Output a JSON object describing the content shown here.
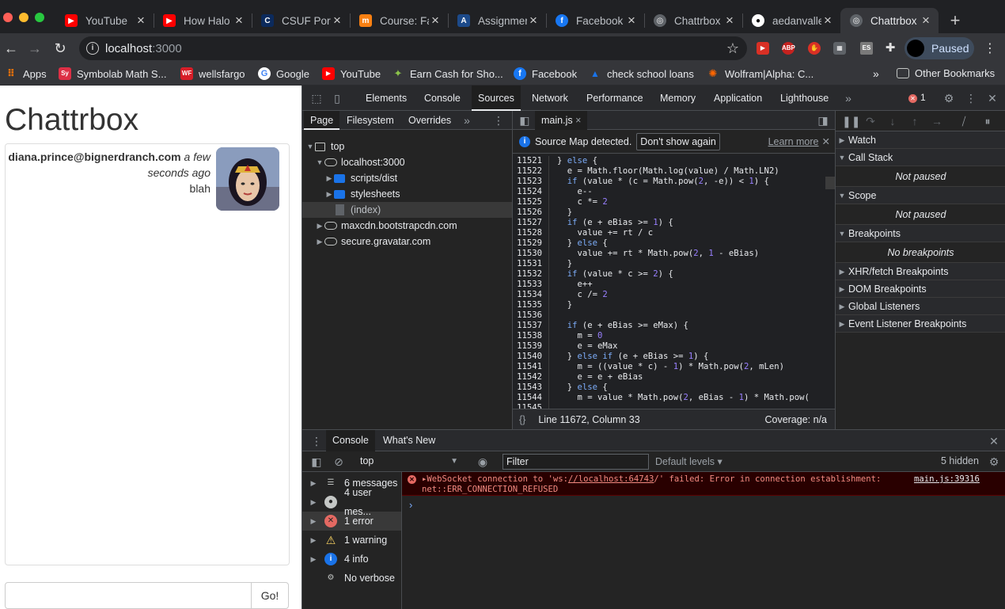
{
  "tabs": [
    {
      "label": "YouTube",
      "icon": "youtube-icon",
      "color": "#ff0000"
    },
    {
      "label": "How Halo",
      "icon": "youtube-icon",
      "color": "#ff0000"
    },
    {
      "label": "CSUF Port",
      "icon": "csuf-icon",
      "color": "#0b2a5c"
    },
    {
      "label": "Course: Fa",
      "icon": "moodle-icon",
      "color": "#f98012"
    },
    {
      "label": "Assignmer",
      "icon": "assignment-icon",
      "color": "#1c4a8a"
    },
    {
      "label": "Facebook",
      "icon": "facebook-icon",
      "color": "#1877f2"
    },
    {
      "label": "Chattrbox",
      "icon": "globe-icon",
      "color": "#9aa0a6"
    },
    {
      "label": "aedanvalle",
      "icon": "github-icon",
      "color": "#ffffff"
    },
    {
      "label": "Chattrbox",
      "icon": "globe-icon",
      "color": "#9aa0a6"
    }
  ],
  "address": {
    "host": "localhost",
    "port": ":3000"
  },
  "profile": {
    "label": "Paused"
  },
  "bookmarks": [
    {
      "label": "Apps",
      "icon": "apps-grid-icon",
      "color": "#e8710a"
    },
    {
      "label": "Symbolab Math S...",
      "icon": "symbolab-icon",
      "color": "#dd2f45"
    },
    {
      "label": "wellsfargo",
      "icon": "wellsfargo-icon",
      "color": "#d71e28"
    },
    {
      "label": "Google",
      "icon": "google-icon",
      "color": "#4285f4"
    },
    {
      "label": "YouTube",
      "icon": "youtube-icon",
      "color": "#ff0000"
    },
    {
      "label": "Earn Cash for Sho...",
      "icon": "earn-cash-icon",
      "color": "#8bc34a"
    },
    {
      "label": "Facebook",
      "icon": "facebook-icon",
      "color": "#1877f2"
    },
    {
      "label": "check school loans",
      "icon": "school-loans-icon",
      "color": "#1a73e8"
    },
    {
      "label": "Wolfram|Alpha: C...",
      "icon": "wolfram-icon",
      "color": "#ff6600"
    }
  ],
  "other_bookmarks": "Other Bookmarks",
  "app": {
    "title": "Chattrbox",
    "message": {
      "sender": "diana.prince@bignerdranch.com",
      "timestamp": "a few seconds ago",
      "body": "blah"
    },
    "go_label": "Go!"
  },
  "devtools": {
    "tabs": [
      "Elements",
      "Console",
      "Sources",
      "Network",
      "Performance",
      "Memory",
      "Application",
      "Lighthouse"
    ],
    "active_tab": "Sources",
    "error_count": "1",
    "navigator_tabs": [
      "Page",
      "Filesystem",
      "Overrides"
    ],
    "tree": {
      "top": "top",
      "host": "localhost:3000",
      "folder1": "scripts/dist",
      "folder2": "stylesheets",
      "index": "(index)",
      "cdn": "maxcdn.bootstrapcdn.com",
      "gravatar": "secure.gravatar.com"
    },
    "editor_tab": "main.js",
    "sourcemap": {
      "message": "Source Map detected.",
      "dismiss": "Don't show again",
      "learn": "Learn more"
    },
    "line_start": 11521,
    "code_lines": [
      "} else {",
      "  e = Math.floor(Math.log(value) / Math.LN2)",
      "  if (value * (c = Math.pow(2, -e)) < 1) {",
      "    e--",
      "    c *= 2",
      "  }",
      "  if (e + eBias >= 1) {",
      "    value += rt / c",
      "  } else {",
      "    value += rt * Math.pow(2, 1 - eBias)",
      "  }",
      "  if (value * c >= 2) {",
      "    e++",
      "    c /= 2",
      "  }",
      "",
      "  if (e + eBias >= eMax) {",
      "    m = 0",
      "    e = eMax",
      "  } else if (e + eBias >= 1) {",
      "    m = ((value * c) - 1) * Math.pow(2, mLen)",
      "    e = e + eBias",
      "  } else {",
      "    m = value * Math.pow(2, eBias - 1) * Math.pow(",
      ""
    ],
    "status": {
      "position": "Line 11672, Column 33",
      "coverage": "Coverage: n/a"
    },
    "debugger": {
      "watch": "Watch",
      "call_stack": "Call Stack",
      "not_paused_1": "Not paused",
      "scope": "Scope",
      "not_paused_2": "Not paused",
      "breakpoints": "Breakpoints",
      "no_breakpoints": "No breakpoints",
      "xhr": "XHR/fetch Breakpoints",
      "dom": "DOM Breakpoints",
      "global": "Global Listeners",
      "event": "Event Listener Breakpoints"
    },
    "drawer_tabs": [
      "Console",
      "What's New"
    ],
    "console": {
      "context": "top",
      "filter_placeholder": "Filter",
      "levels": "Default levels",
      "hidden": "5 hidden",
      "sidebar": [
        {
          "label": "6 messages",
          "icon": "list-icon"
        },
        {
          "label": "4 user mes...",
          "icon": "user-icon"
        },
        {
          "label": "1 error",
          "icon": "error-icon"
        },
        {
          "label": "1 warning",
          "icon": "warning-icon"
        },
        {
          "label": "4 info",
          "icon": "info-icon"
        },
        {
          "label": "No verbose",
          "icon": "verbose-gear-icon"
        }
      ],
      "error_pre": "WebSocket connection to 'ws:",
      "error_link": "//localhost:64743",
      "error_post": "/' failed: Error in connection establishment:",
      "error_line2": "net::ERR_CONNECTION_REFUSED",
      "error_source": "main.js:39316"
    }
  }
}
